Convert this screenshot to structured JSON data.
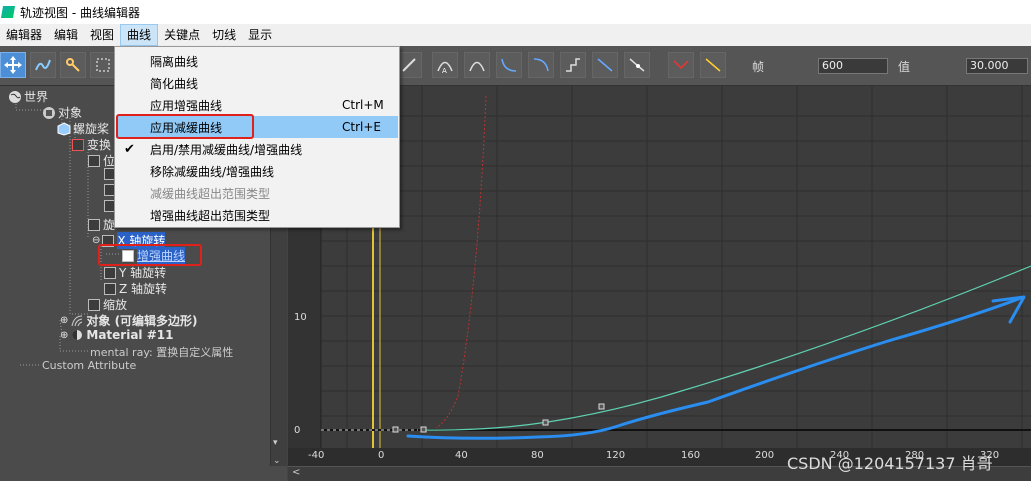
{
  "window": {
    "title": "轨迹视图 - 曲线编辑器"
  },
  "menubar": {
    "items": [
      "编辑器",
      "编辑",
      "视图",
      "曲线",
      "关键点",
      "切线",
      "显示"
    ]
  },
  "toolbar": {
    "frame_label": "帧",
    "frame_value": "600",
    "value_label": "值",
    "value_value": "30.000"
  },
  "dropdown": {
    "items": [
      {
        "label": "隔离曲线",
        "shortcut": ""
      },
      {
        "label": "简化曲线",
        "shortcut": ""
      },
      {
        "label": "应用增强曲线",
        "shortcut": "Ctrl+M"
      },
      {
        "label": "应用减缓曲线",
        "shortcut": "Ctrl+E"
      },
      {
        "label": "启用/禁用减缓曲线/增强曲线",
        "shortcut": ""
      },
      {
        "label": "移除减缓曲线/增强曲线",
        "shortcut": ""
      },
      {
        "label": "减缓曲线超出范围类型",
        "shortcut": ""
      },
      {
        "label": "增强曲线超出范围类型",
        "shortcut": ""
      }
    ]
  },
  "tree": {
    "world": "世界",
    "objects": "对象",
    "propeller": "螺旋桨",
    "transform": "变换",
    "position": "位",
    "rotation": "旋",
    "x_rotation": "X 轴旋转",
    "enhance_curve": "增强曲线",
    "y_rotation": "Y 轴旋转",
    "z_rotation": "Z 轴旋转",
    "scale": "缩放",
    "object_poly": "对象 (可编辑多边形)",
    "material": "Material #11",
    "mental_ray": "mental ray: 置换自定义属性",
    "custom_attr": "Custom Attribute"
  },
  "graph": {
    "y_labels": [
      "10",
      "0"
    ],
    "x_labels": [
      "-40",
      "0",
      "40",
      "80",
      "120",
      "160",
      "200",
      "240",
      "280",
      "320"
    ]
  },
  "watermark": "CSDN @1204157137 肖哥",
  "colors": {
    "menu_highlight": "#91c9f7",
    "annotation_red": "#e0201a",
    "curve_teal": "#5fd0b0",
    "arrow_blue": "#2a8df0"
  }
}
